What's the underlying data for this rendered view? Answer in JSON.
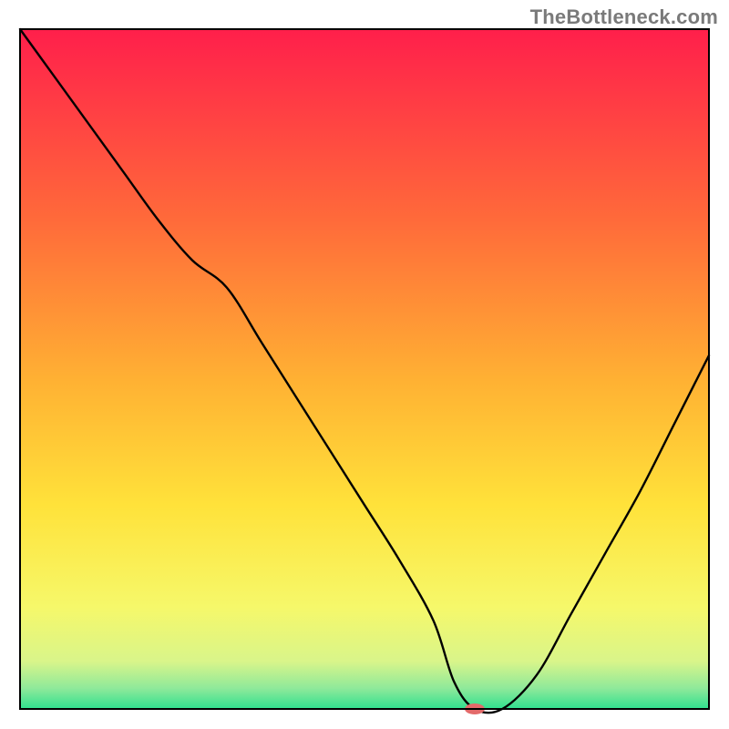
{
  "watermark": "TheBottleneck.com",
  "chart_data": {
    "type": "line",
    "title": "",
    "xlabel": "",
    "ylabel": "",
    "xlim": [
      0,
      100
    ],
    "ylim": [
      0,
      100
    ],
    "grid": false,
    "gradient_bands": [
      {
        "stop": 0.0,
        "color": "#ff1f4b"
      },
      {
        "stop": 0.28,
        "color": "#ff6a3a"
      },
      {
        "stop": 0.52,
        "color": "#ffb233"
      },
      {
        "stop": 0.7,
        "color": "#ffe23a"
      },
      {
        "stop": 0.85,
        "color": "#f6f86a"
      },
      {
        "stop": 0.93,
        "color": "#d9f58a"
      },
      {
        "stop": 0.97,
        "color": "#8ee99a"
      },
      {
        "stop": 1.0,
        "color": "#2fe08f"
      }
    ],
    "series": [
      {
        "name": "bottleneck-curve",
        "x": [
          0,
          5,
          10,
          15,
          20,
          25,
          30,
          35,
          40,
          45,
          50,
          55,
          60,
          63,
          66,
          70,
          75,
          80,
          85,
          90,
          95,
          100
        ],
        "y": [
          100,
          93,
          86,
          79,
          72,
          66,
          62,
          54,
          46,
          38,
          30,
          22,
          13,
          4,
          0,
          0,
          5,
          14,
          23,
          32,
          42,
          52
        ]
      }
    ],
    "marker": {
      "name": "optimal-point",
      "x": 66,
      "y": 0,
      "color": "#e36a6a",
      "rx": 11,
      "ry": 6
    },
    "frame": {
      "inset_top": 32,
      "inset_left": 22,
      "inset_right": 22,
      "inset_bottom": 22,
      "stroke": "#000000",
      "stroke_width": 2
    }
  }
}
